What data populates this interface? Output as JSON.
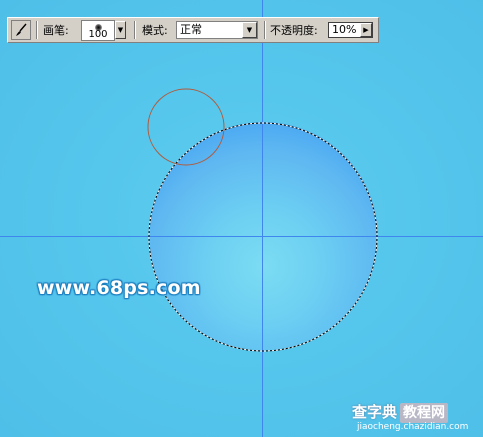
{
  "toolbar": {
    "brush_label": "画笔:",
    "brush_size": "100",
    "mode_label": "模式:",
    "mode_value": "正常",
    "opacity_label": "不透明度:",
    "opacity_value": "10%"
  },
  "icons": {
    "brush_tool": "brush-icon",
    "brush_arrow": "triangle-down",
    "select_arrow": "triangle-down",
    "opacity_arrow": "triangle-right"
  },
  "canvas": {
    "background_color": "#55c6ec",
    "guide_color": "#3f86ee",
    "brush_cursor_color": "#b25a3a",
    "watermark": "www.68ps.com"
  },
  "footer": {
    "site_name": "查字典",
    "site_badge": "教程网",
    "site_url": "jiaocheng.chazidian.com"
  }
}
